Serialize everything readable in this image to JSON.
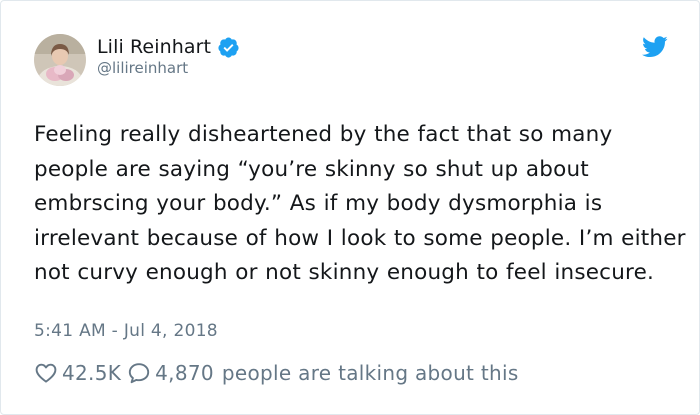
{
  "author": {
    "display_name": "Lili Reinhart",
    "handle": "@lilireinhart",
    "verified": true
  },
  "tweet": {
    "text": "Feeling really disheartened by the fact that so many people are saying “you’re skinny so shut up about embrscing your body.” As if my body dysmorphia is irrelevant because of how I look to some people. I’m either not curvy enough or not skinny enough to feel insecure.",
    "timestamp": "5:41 AM - Jul 4, 2018"
  },
  "stats": {
    "likes": "42.5K",
    "replies": "4,870",
    "talking_label": "people are talking about this"
  },
  "icons": {
    "verified": "verified-badge-icon",
    "twitter": "twitter-bird-icon",
    "like": "heart-icon",
    "reply": "speech-bubble-icon"
  },
  "colors": {
    "accent": "#1da1f2",
    "text": "#14171a",
    "muted": "#657786"
  }
}
